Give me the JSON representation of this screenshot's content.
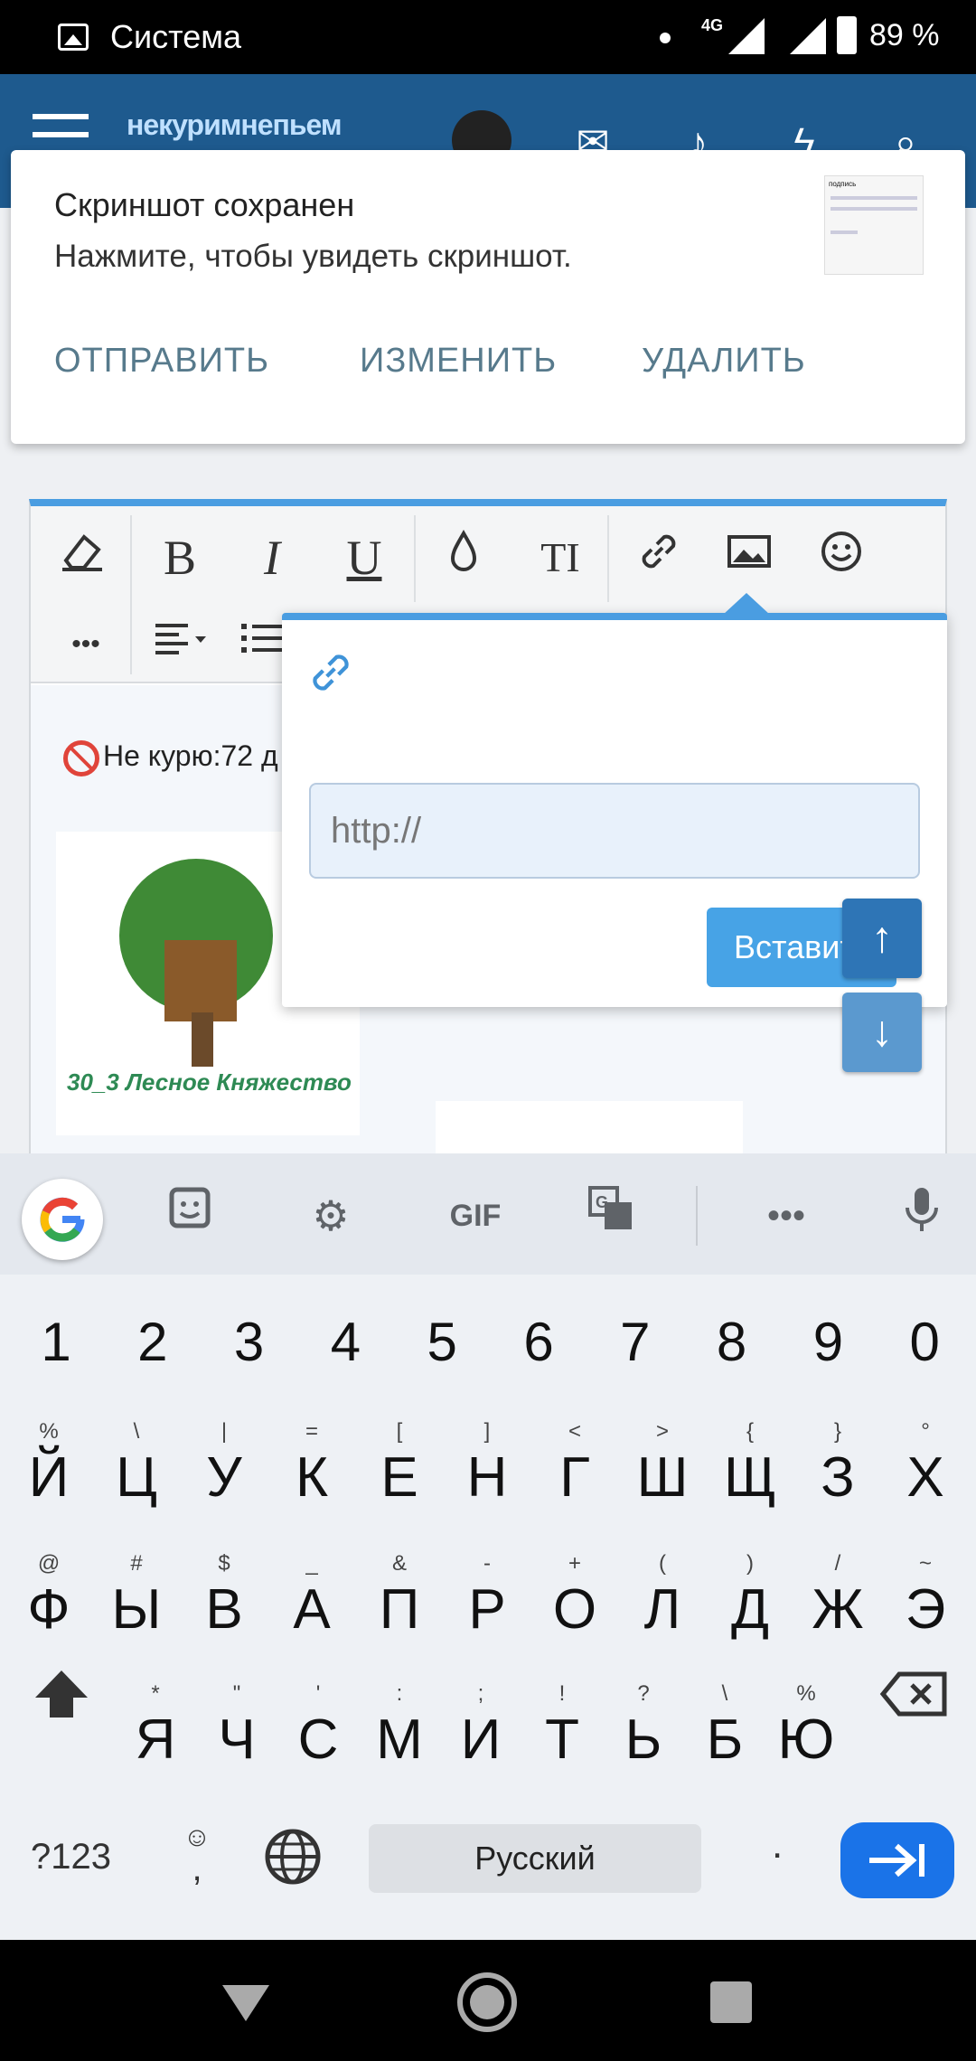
{
  "status_bar": {
    "app_name": "Система",
    "network": "4G",
    "battery": "89 %"
  },
  "site_header": {
    "logo_text": "некуримнепьем"
  },
  "notification": {
    "title": "Скриншот сохранен",
    "text": "Нажмите, чтобы увидеть скриншот.",
    "thumb_text": "подпись",
    "actions": [
      "ОТПРАВИТЬ",
      "ИЗМЕНИТЬ",
      "УДАЛИТЬ"
    ]
  },
  "editor": {
    "toolbar_icons": [
      "eraser-icon",
      "bold-icon",
      "italic-icon",
      "underline-icon",
      "color-drop-icon",
      "text-size-icon",
      "link-icon",
      "image-icon",
      "smiley-icon",
      "more-icon",
      "align-icon",
      "list-icon"
    ],
    "bold_glyph": "B",
    "italic_glyph": "I",
    "underline_glyph": "U",
    "textsize_glyph": "TI",
    "more_glyph": "•••",
    "content_line": "Не курю:72 д",
    "tree_caption": "30_3 Лесное Княжество"
  },
  "link_popup": {
    "placeholder": "http://",
    "insert_label": "Вставить"
  },
  "keyboard": {
    "language": "Русский",
    "numbers_key": "?123",
    "period_key": ".",
    "comma_key": ",",
    "gif_label": "GIF",
    "number_row": [
      "1",
      "2",
      "3",
      "4",
      "5",
      "6",
      "7",
      "8",
      "9",
      "0"
    ],
    "row1": [
      {
        "main": "Й",
        "hint": "%"
      },
      {
        "main": "Ц",
        "hint": "\\"
      },
      {
        "main": "У",
        "hint": "|"
      },
      {
        "main": "К",
        "hint": "="
      },
      {
        "main": "Е",
        "hint": "["
      },
      {
        "main": "Н",
        "hint": "]"
      },
      {
        "main": "Г",
        "hint": "<"
      },
      {
        "main": "Ш",
        "hint": ">"
      },
      {
        "main": "Щ",
        "hint": "{"
      },
      {
        "main": "З",
        "hint": "}"
      },
      {
        "main": "Х",
        "hint": "°"
      }
    ],
    "row2": [
      {
        "main": "Ф",
        "hint": "@"
      },
      {
        "main": "Ы",
        "hint": "#"
      },
      {
        "main": "В",
        "hint": "$"
      },
      {
        "main": "А",
        "hint": "_"
      },
      {
        "main": "П",
        "hint": "&"
      },
      {
        "main": "Р",
        "hint": "-"
      },
      {
        "main": "О",
        "hint": "+"
      },
      {
        "main": "Л",
        "hint": "("
      },
      {
        "main": "Д",
        "hint": ")"
      },
      {
        "main": "Ж",
        "hint": "/"
      },
      {
        "main": "Э",
        "hint": "~"
      }
    ],
    "row3": [
      {
        "main": "Я",
        "hint": "*"
      },
      {
        "main": "Ч",
        "hint": "\""
      },
      {
        "main": "С",
        "hint": "'"
      },
      {
        "main": "М",
        "hint": ":"
      },
      {
        "main": "И",
        "hint": ";"
      },
      {
        "main": "Т",
        "hint": "!"
      },
      {
        "main": "Ь",
        "hint": "?"
      },
      {
        "main": "Б",
        "hint": "\\"
      },
      {
        "main": "Ю",
        "hint": "%"
      }
    ]
  }
}
